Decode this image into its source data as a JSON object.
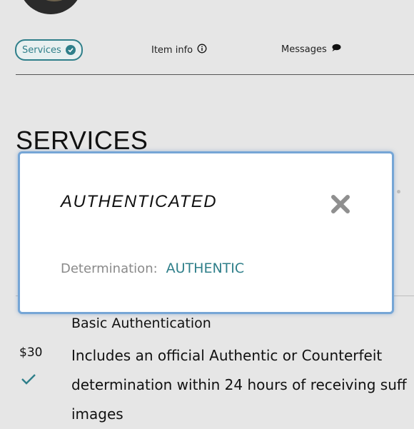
{
  "tabs": {
    "services": "Services",
    "item_info": "Item info",
    "messages": "Messages"
  },
  "section": {
    "title": "SERVICES"
  },
  "service": {
    "name": "Basic Authentication",
    "price": "$30",
    "desc_line1": "Includes an official Authentic or Counterfeit",
    "desc_line2": "determination within 24 hours of receiving suff",
    "desc_line3": "images"
  },
  "modal": {
    "title": "AUTHENTICATED",
    "determination_label": "Determination:",
    "determination_value": "AUTHENTIC",
    "close_icon": "close-x-icon"
  },
  "colors": {
    "accent": "#2f7f8a",
    "modal_border": "#76a6d6",
    "background": "#e6e6e6",
    "muted_text": "#8a8a8a"
  }
}
